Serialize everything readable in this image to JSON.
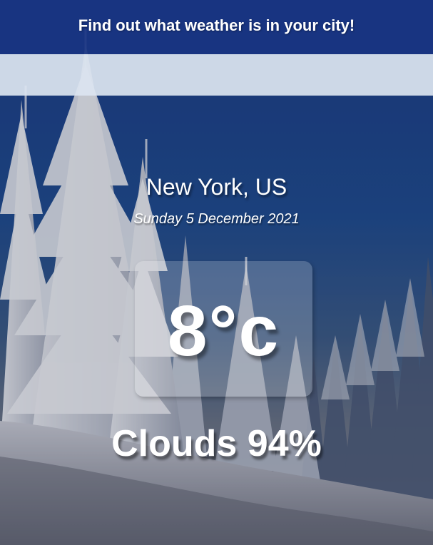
{
  "header": {
    "title": "Find out what weather is in your city!"
  },
  "search": {
    "placeholder": "",
    "value": ""
  },
  "weather": {
    "location": "New York, US",
    "date": "Sunday 5 December 2021",
    "temperature": "8°c",
    "condition": "Clouds 94%"
  },
  "background": {
    "scene": "snowy-pine-forest",
    "sky_color": "#1b3a86",
    "snow_color": "#f2f4f8"
  }
}
